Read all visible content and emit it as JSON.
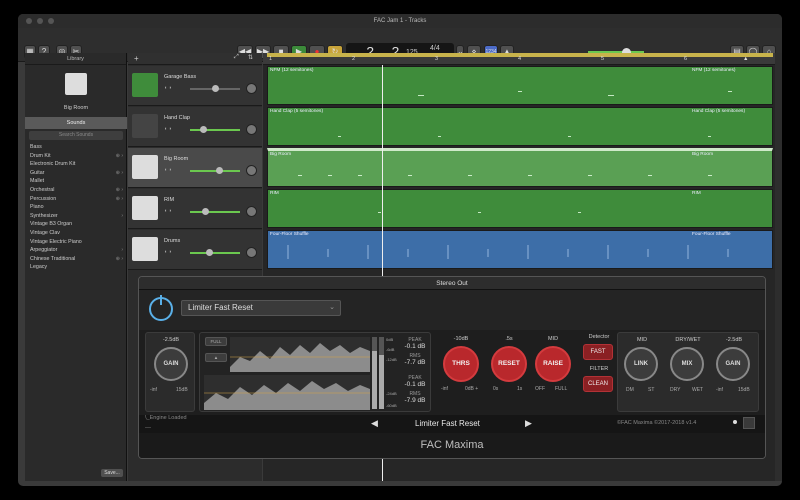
{
  "window": {
    "title": "FAC Jam 1 - Tracks"
  },
  "transport": {
    "position": "2. 2",
    "bar_label": "BAR",
    "beat_label": "BEAT",
    "tempo": "125",
    "tempo_label": "TEMPO",
    "time_sig": "4/4",
    "key": "Dmaj",
    "count_in": "1234"
  },
  "library": {
    "header": "Library",
    "preset_name": "Big Room",
    "tab": "Sounds",
    "search_placeholder": "Search Sounds",
    "items": [
      "Bass",
      "Drum Kit",
      "Electronic Drum Kit",
      "Guitar",
      "Mallet",
      "Orchestral",
      "Percussion",
      "Piano",
      "Synthesizer",
      "Vintage B3 Organ",
      "Vintage Clav",
      "Vintage Electric Piano",
      "Arpeggiator",
      "Chinese Traditional",
      "Legacy"
    ],
    "save_label": "Save..."
  },
  "tracks": [
    {
      "name": "Garage Bass",
      "color": "#3f8c3b"
    },
    {
      "name": "Hand Clap",
      "color": "#3f8c3b"
    },
    {
      "name": "Big Room",
      "color": "#5aa054"
    },
    {
      "name": "RIM",
      "color": "#3f8c3b"
    },
    {
      "name": "Drums",
      "color": "#3d6ea8"
    }
  ],
  "regions": [
    {
      "label": "NFM (12 semitones)",
      "label2": "NFM (12 semitones)"
    },
    {
      "label": "Hand Clap (5 semitones)",
      "label2": "Hand Clap (5 semitones)"
    },
    {
      "label": "Big Room",
      "label2": "Big Room"
    },
    {
      "label": "RIM",
      "label2": "RIM"
    },
    {
      "label": "Four-Floor Shuffle",
      "label2": "Four-Floor Shuffle"
    }
  ],
  "ruler": {
    "marks": [
      "1",
      "2",
      "3",
      "4",
      "5",
      "6",
      "7",
      "8"
    ]
  },
  "plugin": {
    "window_title": "Stereo Out",
    "preset": "Limiter Fast Reset",
    "gain_in": {
      "value": "-2.5dB",
      "label": "GAIN",
      "min": "-inf",
      "max": "15dB"
    },
    "meter_buttons": [
      "FULL",
      "▲"
    ],
    "peak_top": {
      "label": "PEAK",
      "value": "-0.1 dB"
    },
    "rms_top": {
      "label": "RMS",
      "value": "-7.7 dB"
    },
    "peak_bot": {
      "label": "PEAK",
      "value": "-0.1 dB"
    },
    "rms_bot": {
      "label": "RMS",
      "value": "-7.9 dB"
    },
    "meter_scale": [
      "0dB",
      "-6dB",
      "-12dB",
      "-24dB",
      "-60dB"
    ],
    "thrs": {
      "value": "-10dB",
      "label": "THRS",
      "min": "-inf",
      "max": "0dB +"
    },
    "reset": {
      "value": ".5s",
      "label": "RESET",
      "min": "0s",
      "max": "1s"
    },
    "raise": {
      "value": "MID",
      "label": "RAISE",
      "min": "OFF",
      "max": "FULL"
    },
    "detector": {
      "label": "Detector",
      "fast": "FAST",
      "filter": "FILTER",
      "clean": "CLEAN"
    },
    "link": {
      "value": "MID",
      "label": "LINK",
      "min": "DM",
      "max": "ST"
    },
    "mix": {
      "value": "DRY/WET",
      "label": "MIX",
      "min": "DRY",
      "max": "WET"
    },
    "gain_out": {
      "value": "-2.5dB",
      "label": "GAIN",
      "min": "-inf",
      "max": "15dB"
    },
    "engine_status": "\\_Engine Loaded",
    "footer_dash": "---",
    "current_preset": "Limiter Fast Reset",
    "copyright": "©FAC Maxima ©2017-2018 v1.4",
    "brand": "FAC Maxima"
  }
}
